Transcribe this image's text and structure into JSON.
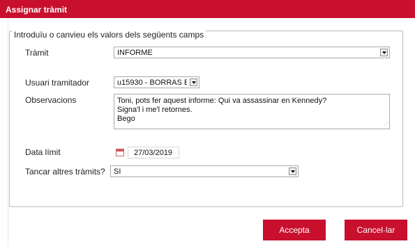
{
  "dialog": {
    "title": "Assignar tràmit"
  },
  "form": {
    "legend": "Introduïu o canvieu els valors dels següents camps",
    "tramit": {
      "label": "Tràmit",
      "value": "INFORME"
    },
    "usuari": {
      "label": "Usuari tramitador",
      "value": "u15930 - BORRAS E"
    },
    "observacions": {
      "label": "Observacions",
      "value": "Toni, pots fer aquest informe: Qui va assassinar en Kennedy?\nSigna'l i me'l retornes.\nBego"
    },
    "data_limit": {
      "label": "Data límit",
      "value": "27/03/2019"
    },
    "tancar": {
      "label": "Tancar altres tràmits?",
      "value": "SI"
    }
  },
  "buttons": {
    "accept": "Accepta",
    "cancel": "Cancel·lar"
  },
  "icons": {
    "dropdown": "chevron-down-icon",
    "calendar": "calendar-icon",
    "resize": "resize-grip-icon"
  },
  "colors": {
    "accent": "#c8102e"
  }
}
